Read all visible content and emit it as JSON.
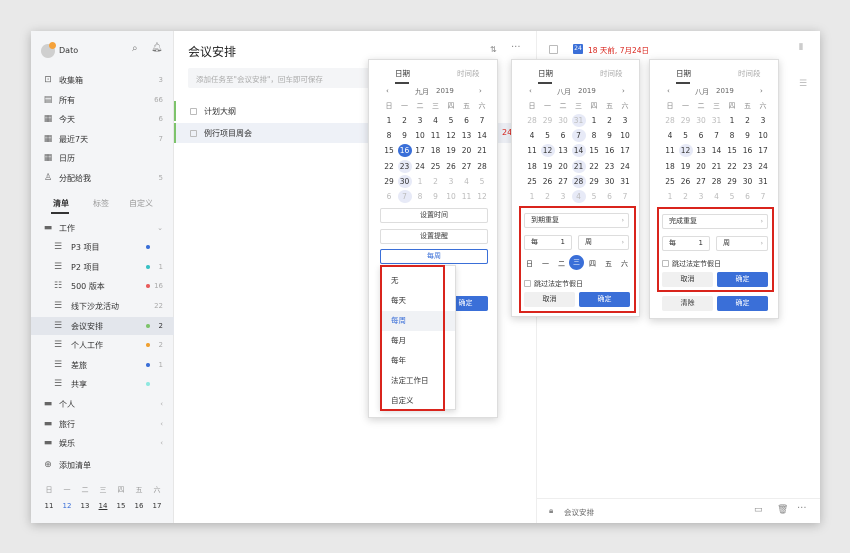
{
  "app": {
    "name": "Dato"
  },
  "sidebar": {
    "items": [
      {
        "label": "收集箱",
        "count": "3"
      },
      {
        "label": "所有",
        "count": "66"
      },
      {
        "label": "今天",
        "count": "6"
      },
      {
        "label": "最近7天",
        "count": "7"
      },
      {
        "label": "日历",
        "count": ""
      },
      {
        "label": "分配给我",
        "count": "5"
      }
    ],
    "tabs": [
      "清单",
      "标签",
      "自定义"
    ],
    "groups": {
      "work": "工作",
      "personal": "个人",
      "travel": "旅行",
      "fun": "娱乐",
      "add_list": "添加清单"
    },
    "work_lists": [
      {
        "label": "P3 项目",
        "count": "",
        "color": "#3a6fd8"
      },
      {
        "label": "P2 项目",
        "count": "1",
        "color": "#39c1c4"
      },
      {
        "label": "500 版本",
        "count": "16",
        "color": "#e85c5c"
      },
      {
        "label": "线下沙龙活动",
        "count": "22",
        "color": ""
      },
      {
        "label": "会议安排",
        "count": "2",
        "color": "#7dc36b"
      },
      {
        "label": "个人工作",
        "count": "2",
        "color": "#f0a030"
      },
      {
        "label": "差旅",
        "count": "1",
        "color": "#3a6fd8"
      },
      {
        "label": "共享",
        "count": "",
        "color": "#8ee8e0"
      }
    ],
    "mini_week": [
      "日",
      "一",
      "二",
      "三",
      "四",
      "五",
      "六"
    ],
    "mini_days": [
      "11",
      "12",
      "13",
      "14",
      "15",
      "16",
      "17"
    ]
  },
  "main": {
    "title": "会议安排",
    "add_placeholder": "添加任务至\"会议安排\"，回车即可保存",
    "tasks": [
      "计划大纲",
      "例行项目周会"
    ],
    "overflow": "24"
  },
  "detail": {
    "date_badge": "24",
    "date_text": "18 天前, 7月24日",
    "footer_list": "会议安排"
  },
  "popup1": {
    "tabs": [
      "日期",
      "时间段"
    ],
    "month": "九月",
    "year": "2019",
    "weekdays": [
      "日",
      "一",
      "二",
      "三",
      "四",
      "五",
      "六"
    ],
    "rows": [
      [
        "1",
        "2",
        "3",
        "4",
        "5",
        "6",
        "7"
      ],
      [
        "8",
        "9",
        "10",
        "11",
        "12",
        "13",
        "14"
      ],
      [
        "15",
        "16",
        "17",
        "18",
        "19",
        "20",
        "21"
      ],
      [
        "22",
        "23",
        "24",
        "25",
        "26",
        "27",
        "28"
      ],
      [
        "29",
        "30",
        "1",
        "2",
        "3",
        "4",
        "5"
      ],
      [
        "6",
        "7",
        "8",
        "9",
        "10",
        "11",
        "12"
      ]
    ],
    "set_time": "设置时间",
    "set_reminder": "设置提醒",
    "repeat_value": "每周",
    "dropdown": [
      "无",
      "每天",
      "每周",
      "每月",
      "每年",
      "法定工作日",
      "自定义"
    ],
    "confirm": "确定"
  },
  "popup2": {
    "tabs": [
      "日期",
      "时间段"
    ],
    "month": "八月",
    "year": "2019",
    "weekdays": [
      "日",
      "一",
      "二",
      "三",
      "四",
      "五",
      "六"
    ],
    "rows": [
      [
        "28",
        "29",
        "30",
        "31",
        "1",
        "2",
        "3"
      ],
      [
        "4",
        "5",
        "6",
        "7",
        "8",
        "9",
        "10"
      ],
      [
        "11",
        "12",
        "13",
        "14",
        "15",
        "16",
        "17"
      ],
      [
        "18",
        "19",
        "20",
        "21",
        "22",
        "23",
        "24"
      ],
      [
        "25",
        "26",
        "27",
        "28",
        "29",
        "30",
        "31"
      ],
      [
        "1",
        "2",
        "3",
        "4",
        "5",
        "6",
        "7"
      ]
    ],
    "repeat_type": "到期重复",
    "every": "每",
    "interval": "1",
    "unit": "周",
    "week_row": [
      "日",
      "一",
      "二",
      "三",
      "四",
      "五",
      "六"
    ],
    "skip_holiday": "跳过法定节假日",
    "cancel": "取消",
    "confirm": "确定"
  },
  "popup3": {
    "tabs": [
      "日期",
      "时间段"
    ],
    "month": "八月",
    "year": "2019",
    "weekdays": [
      "日",
      "一",
      "二",
      "三",
      "四",
      "五",
      "六"
    ],
    "rows": [
      [
        "28",
        "29",
        "30",
        "31",
        "1",
        "2",
        "3"
      ],
      [
        "4",
        "5",
        "6",
        "7",
        "8",
        "9",
        "10"
      ],
      [
        "11",
        "12",
        "13",
        "14",
        "15",
        "16",
        "17"
      ],
      [
        "18",
        "19",
        "20",
        "21",
        "22",
        "23",
        "24"
      ],
      [
        "25",
        "26",
        "27",
        "28",
        "29",
        "30",
        "31"
      ],
      [
        "1",
        "2",
        "3",
        "4",
        "5",
        "6",
        "7"
      ]
    ],
    "repeat_type": "完成重复",
    "every": "每",
    "interval": "1",
    "unit": "周",
    "skip_holiday": "跳过法定节假日",
    "cancel": "取消",
    "confirm": "确定",
    "clear": "清除",
    "confirm2": "确定"
  },
  "colors": {
    "accent": "#3a6fd8",
    "highlight": "#d9241c"
  }
}
